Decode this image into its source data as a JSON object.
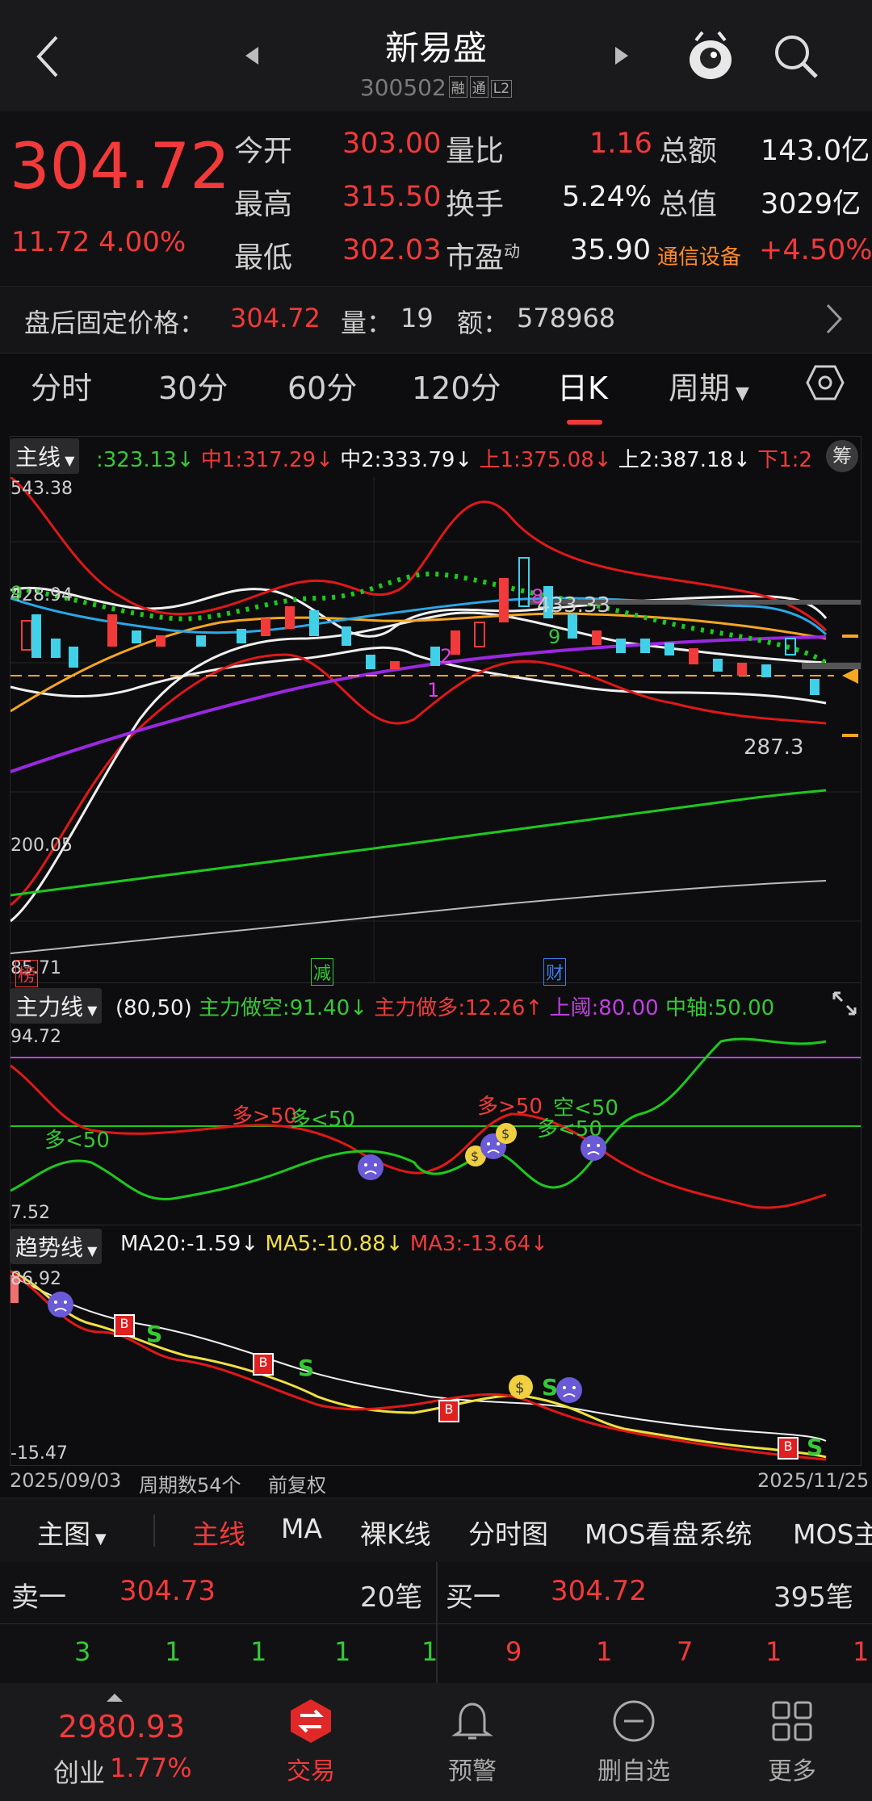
{
  "header": {
    "title": "新易盛",
    "code": "300502",
    "tags": [
      "融",
      "通",
      "L2"
    ]
  },
  "quote": {
    "price": "304.72",
    "change": "11.72",
    "change_pct": "4.00%",
    "rows": [
      [
        {
          "l": "今开",
          "v": "303.00",
          "c": "red"
        },
        {
          "l": "量比",
          "v": "1.16",
          "c": "red"
        },
        {
          "l": "总额",
          "v": "143.0亿",
          "c": "white"
        }
      ],
      [
        {
          "l": "最高",
          "v": "315.50",
          "c": "red"
        },
        {
          "l": "换手",
          "v": "5.24%",
          "c": "white"
        },
        {
          "l": "总值",
          "v": "3029亿",
          "c": "white"
        }
      ],
      [
        {
          "l": "最低",
          "v": "302.03",
          "c": "red"
        },
        {
          "l": "市盈",
          "v": "35.90",
          "c": "white"
        },
        {
          "l": "通信设备",
          "v": "+4.50%",
          "c": "red"
        }
      ]
    ],
    "pe_sup": "动"
  },
  "after_hours": {
    "label": "盘后固定价格：",
    "price": "304.72",
    "vol_label": "量：",
    "vol": "19",
    "amt_label": "额：",
    "amt": "578968"
  },
  "tabs": [
    "分时",
    "30分",
    "60分",
    "120分",
    "日K",
    "周期"
  ],
  "main_indicator": {
    "name": "主线",
    "items": [
      {
        "t": ":323.13↓",
        "c": "#36c936"
      },
      {
        "t": "中1:317.29↓",
        "c": "#f23a3a"
      },
      {
        "t": "中2:333.79↓",
        "c": "#f0f0f0"
      },
      {
        "t": "上1:375.08↓",
        "c": "#f23a3a"
      },
      {
        "t": "上2:387.18↓",
        "c": "#f0f0f0"
      },
      {
        "t": "下1:2",
        "c": "#f23a3a"
      }
    ],
    "chip_right": "筹",
    "axis": [
      "543.38",
      "428.94",
      "200.05",
      "85.71"
    ],
    "labels": {
      "hi": "433.33",
      "lo": "287.3"
    },
    "markers": [
      "榜",
      "减",
      "财"
    ],
    "nums": [
      "9",
      "8",
      "9",
      "2",
      "1"
    ]
  },
  "power": {
    "name": "主力线",
    "params": "(80,50)",
    "items": [
      {
        "t": "主力做空:91.40↓",
        "c": "#36c936"
      },
      {
        "t": "主力做多:12.26↑",
        "c": "#f23a3a"
      },
      {
        "t": "上阈:80.00",
        "c": "#c040e0"
      },
      {
        "t": "中轴:50.00",
        "c": "#36c936"
      }
    ],
    "axis": [
      "94.72",
      "7.52"
    ],
    "anns": [
      {
        "t": "多<50",
        "c": "#36c936"
      },
      {
        "t": "多>50",
        "c": "#f23a3a"
      },
      {
        "t": "多<50",
        "c": "#36c936"
      },
      {
        "t": "多>50",
        "c": "#f23a3a"
      },
      {
        "t": "空<50",
        "c": "#36c936"
      },
      {
        "t": "多<50",
        "c": "#36c936"
      }
    ]
  },
  "trend": {
    "name": "趋势线",
    "items": [
      {
        "t": "MA20:-1.59↓",
        "c": "#f0f0f0"
      },
      {
        "t": "MA5:-10.88↓",
        "c": "#f0e040"
      },
      {
        "t": "MA3:-13.64↓",
        "c": "#f23a3a"
      }
    ],
    "axis": [
      "86.92",
      "-15.47"
    ]
  },
  "footer": {
    "start": "2025/09/03",
    "period": "周期数54个",
    "adj": "前复权",
    "end": "2025/11/25"
  },
  "subtabs": [
    "主图",
    "主线",
    "MA",
    "裸K线",
    "分时图",
    "MOS看盘系统",
    "MOS主"
  ],
  "order": {
    "sell": {
      "label": "卖一",
      "price": "304.73",
      "count": "20笔",
      "qty": [
        "3",
        "1",
        "1",
        "1",
        "1"
      ]
    },
    "buy": {
      "label": "买一",
      "price": "304.72",
      "count": "395笔",
      "qty": [
        "9",
        "1",
        "7",
        "1",
        "1"
      ]
    }
  },
  "nav": {
    "index_val": "2980.93",
    "index_name": "创业",
    "index_pct": "1.77%",
    "items": [
      "交易",
      "预警",
      "删自选",
      "更多"
    ]
  }
}
